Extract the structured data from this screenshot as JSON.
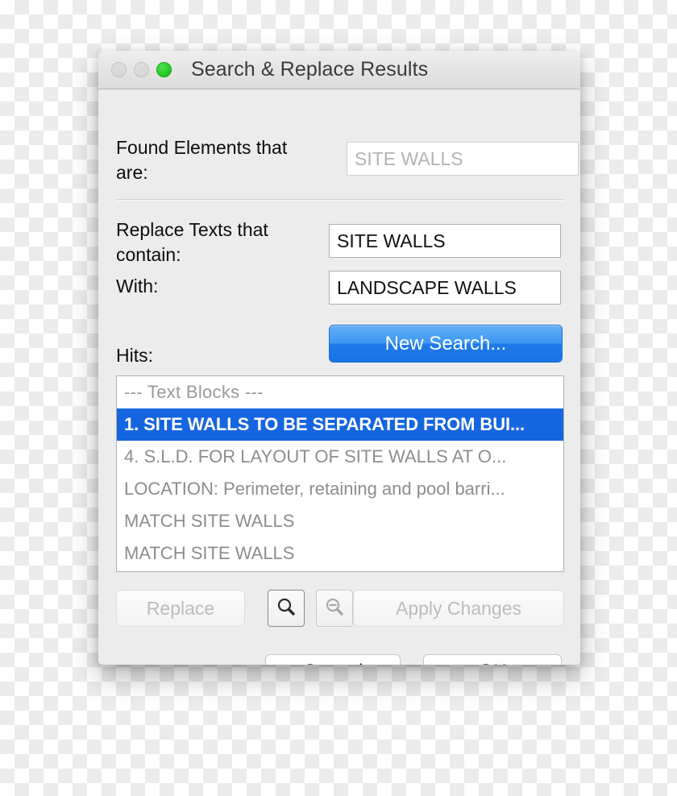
{
  "window": {
    "title": "Search & Replace Results",
    "traffic_lights": [
      {
        "name": "close",
        "state": "disabled",
        "color": "#d8d8d8"
      },
      {
        "name": "minimize",
        "state": "disabled",
        "color": "#d8d8d8"
      },
      {
        "name": "zoom",
        "state": "active",
        "color": "#29cc29"
      }
    ]
  },
  "fields": {
    "found_label": "Found Elements that are:",
    "found_value": "SITE WALLS",
    "found_disabled": true,
    "replace_label": "Replace Texts that contain:",
    "replace_value": "SITE WALLS",
    "with_label": "With:",
    "with_value": "LANDSCAPE WALLS"
  },
  "buttons": {
    "new_search": "New Search...",
    "replace": "Replace",
    "apply_changes": "Apply Changes",
    "cancel": "Cancel",
    "ok": "OK",
    "zoom_in_icon": "magnifier-icon",
    "zoom_out_icon": "magnifier-minus-icon"
  },
  "hits": {
    "label": "Hits:",
    "rows": [
      {
        "text": "---  Text Blocks  ---",
        "type": "group-header",
        "selected": false
      },
      {
        "text": "1. SITE WALLS TO BE SEPARATED FROM BUI...",
        "type": "hit",
        "selected": true
      },
      {
        "text": "4.  S.L.D. FOR LAYOUT OF SITE WALLS AT O...",
        "type": "hit",
        "selected": false
      },
      {
        "text": "LOCATION: Perimeter, retaining and pool barri...",
        "type": "hit",
        "selected": false
      },
      {
        "text": "MATCH SITE WALLS",
        "type": "hit",
        "selected": false
      },
      {
        "text": "MATCH SITE WALLS",
        "type": "hit",
        "selected": false
      }
    ]
  },
  "colors": {
    "accent_blue": "#1a72e3",
    "selection_blue": "#1565e0",
    "window_background": "#ececec",
    "disabled_text": "#bcbcbc"
  }
}
